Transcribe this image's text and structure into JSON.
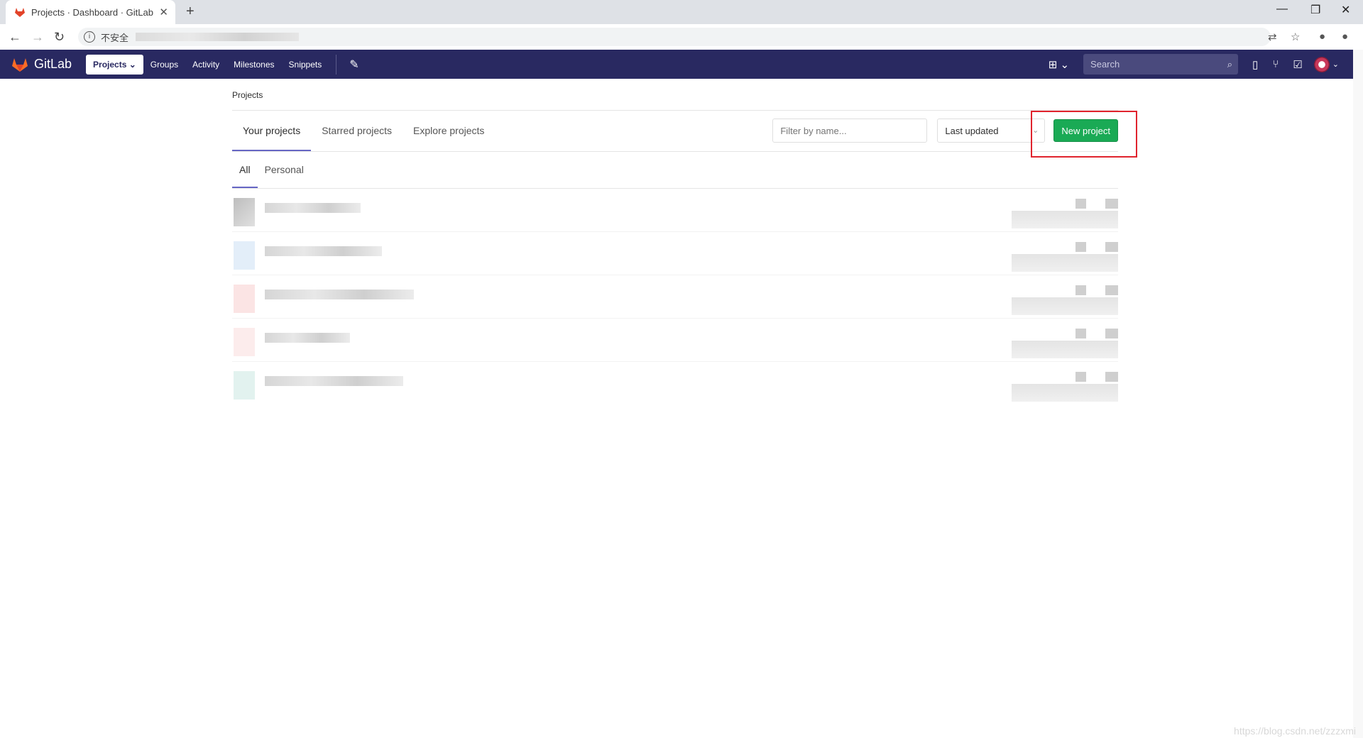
{
  "browser": {
    "tab_title": "Projects · Dashboard · GitLab",
    "insecure_label": "不安全",
    "close_tab": "✕",
    "new_tab": "+"
  },
  "navbar": {
    "brand": "GitLab",
    "links": [
      "Projects",
      "Groups",
      "Activity",
      "Milestones",
      "Snippets"
    ],
    "search_placeholder": "Search"
  },
  "breadcrumb": "Projects",
  "tabs": [
    "Your projects",
    "Starred projects",
    "Explore projects"
  ],
  "filter_placeholder": "Filter by name...",
  "sort_selected": "Last updated",
  "new_project_label": "New project",
  "subtabs": [
    "All",
    "Personal"
  ],
  "watermark": "https://blog.csdn.net/zzzxmi",
  "colors": {
    "navbar_bg": "#292961",
    "new_project_bg": "#1aaa55",
    "highlight_border": "#e0232d",
    "tab_underline": "#6666c4"
  }
}
